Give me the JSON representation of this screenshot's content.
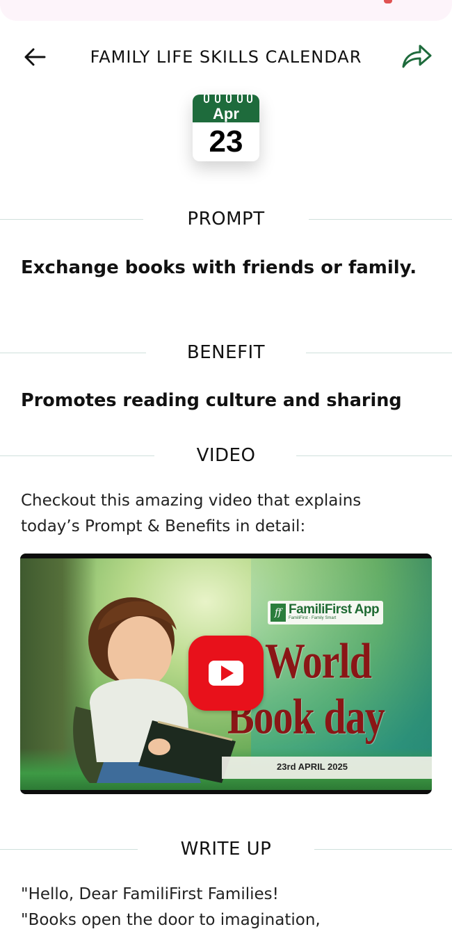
{
  "header": {
    "title": "FAMILY LIFE SKILLS CALENDAR",
    "back_icon": "arrow-left-icon",
    "share_icon": "share-arrow-icon"
  },
  "calendar": {
    "month": "Apr",
    "day": "23"
  },
  "sections": {
    "prompt": {
      "label": "PROMPT",
      "text": "Exchange books with friends or family."
    },
    "benefit": {
      "label": "BENEFIT",
      "text": "Promotes reading culture and sharing"
    },
    "video": {
      "label": "VIDEO",
      "intro": "Checkout this amazing video that explains today’s Prompt & Benefits in detail:",
      "thumbnail": {
        "brand": "FamiliFirst App",
        "brand_sub": "FamiliFirst - Family Smart",
        "title_line1": "World",
        "title_line2": "Book day",
        "date": "23rd APRIL 2025",
        "play_icon": "youtube-play-icon"
      }
    },
    "write_up": {
      "label": "WRITE UP",
      "line1": "\"Hello, Dear FamiliFirst Families!",
      "line2": "\"Books open the door to imagination,"
    }
  },
  "colors": {
    "accent_green": "#1e6b3c",
    "divider": "#cfe0dc",
    "youtube_red": "#e8111b",
    "title_red": "#8a1616"
  }
}
